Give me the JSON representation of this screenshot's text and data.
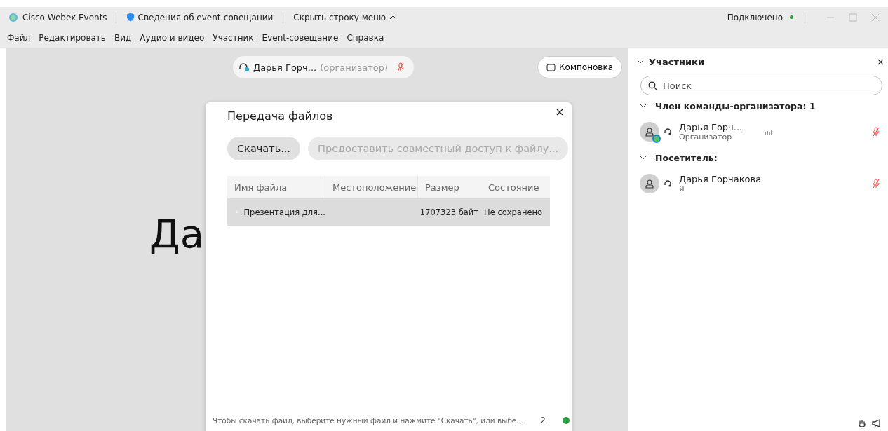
{
  "title_bar": {
    "app_name": "Cisco Webex Events",
    "meeting_info": "Сведения об event-совещании",
    "hide_menu": "Скрыть строку меню",
    "status": "Подключено"
  },
  "menu": [
    "Файл",
    "Редактировать",
    "Вид",
    "Аудио и видео",
    "Участник",
    "Event-совещание",
    "Справка"
  ],
  "stage": {
    "speaker": {
      "name": "Дарья Горч...",
      "role": "(организатор)",
      "muted": true
    },
    "layout_button": "Компоновка",
    "stage_name": "Да"
  },
  "dialog": {
    "title": "Передача файлов",
    "buttons": [
      {
        "label": "Скачать...",
        "disabled": false
      },
      {
        "label": "Предоставить совместный доступ к файлу...",
        "disabled": true
      }
    ],
    "columns": [
      "Имя файла",
      "Местоположение",
      "Размер",
      "Состояние"
    ],
    "rows": [
      {
        "name": "Презентация для...",
        "location": "",
        "size": "1707323 байт",
        "status": "Не сохранено",
        "selected": true
      }
    ],
    "footer": {
      "hint": "Чтобы скачать файл, выберите нужный файл и нажмите \"Скачать\", или выбе...",
      "count": "2"
    }
  },
  "participants": {
    "title": "Участники",
    "search": {
      "placeholder": "Поиск"
    },
    "groups": [
      {
        "label": "Член команды-организатора: 1",
        "expanded": true,
        "members": [
          {
            "name": "Дарья Горч...",
            "role": "Организатор",
            "host": true,
            "muted": true
          }
        ]
      },
      {
        "label": "Посетитель:",
        "expanded": true,
        "members": [
          {
            "name": "Дарья Горчакова",
            "role": "Я",
            "host": false,
            "muted": true
          }
        ]
      }
    ]
  }
}
